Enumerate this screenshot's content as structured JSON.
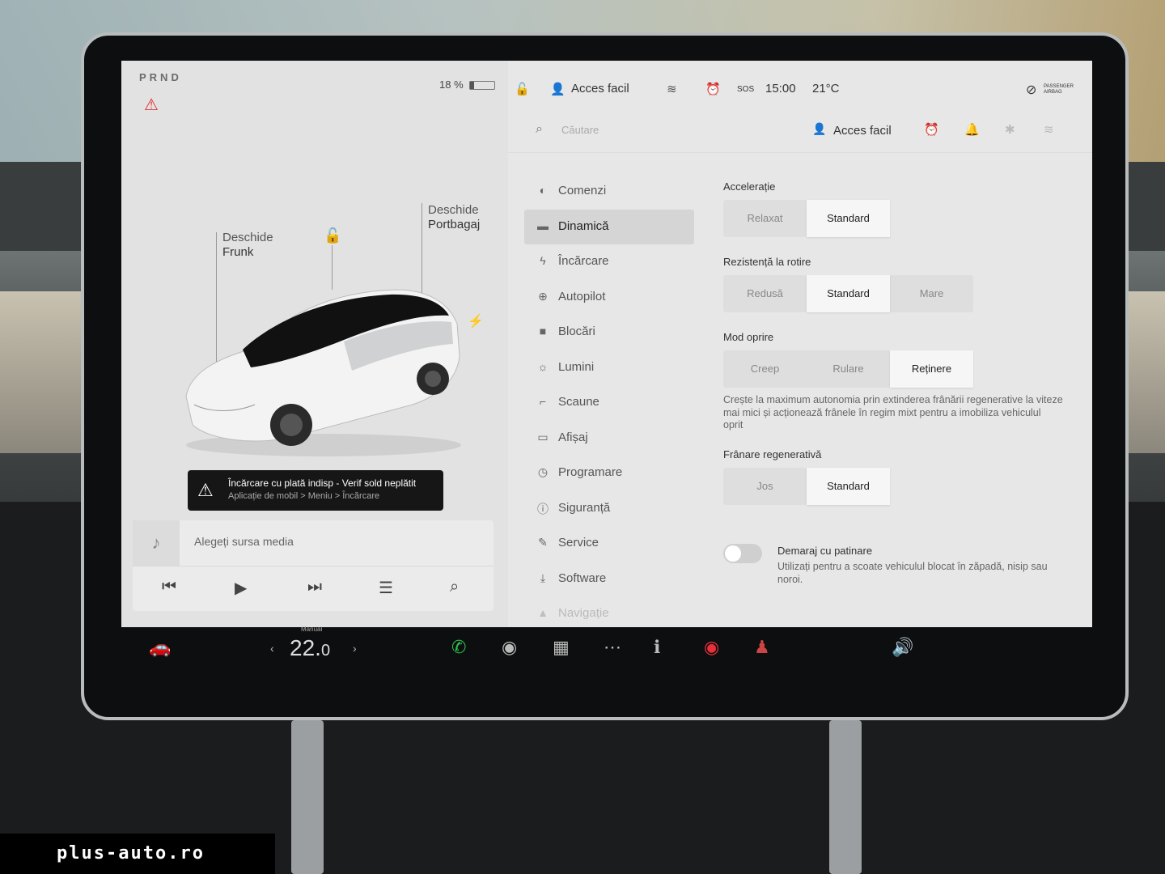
{
  "left": {
    "gear": "PRND",
    "battery_percent": "18 %",
    "battery_level": 0.18,
    "frunk_label_1": "Deschide",
    "frunk_label_2": "Frunk",
    "trunk_label_1": "Deschide",
    "trunk_label_2": "Portbagaj",
    "alert_title": "Încărcare cu plată indisp - Verif sold neplătit",
    "alert_sub": "Aplicație de mobil > Meniu > Încărcare",
    "media_source": "Alegeți sursa media"
  },
  "status": {
    "profile": "Acces facil",
    "sos": "SOS",
    "time": "15:00",
    "temperature": "21°C",
    "airbag": "PASSENGER AIRBAG"
  },
  "search": {
    "placeholder": "Căutare",
    "profile": "Acces facil"
  },
  "menu": [
    {
      "label": "Comenzi",
      "icon": "toggle-icon"
    },
    {
      "label": "Dinamică",
      "icon": "car-icon"
    },
    {
      "label": "Încărcare",
      "icon": "bolt-icon"
    },
    {
      "label": "Autopilot",
      "icon": "steering-icon"
    },
    {
      "label": "Blocări",
      "icon": "lock-icon"
    },
    {
      "label": "Lumini",
      "icon": "sun-icon"
    },
    {
      "label": "Scaune",
      "icon": "seat-icon"
    },
    {
      "label": "Afișaj",
      "icon": "display-icon"
    },
    {
      "label": "Programare",
      "icon": "clock-icon"
    },
    {
      "label": "Siguranță",
      "icon": "info-icon"
    },
    {
      "label": "Service",
      "icon": "wrench-icon"
    },
    {
      "label": "Software",
      "icon": "download-icon"
    },
    {
      "label": "Navigație",
      "icon": "navigation-icon"
    }
  ],
  "settings": {
    "acceleration": {
      "title": "Accelerație",
      "options": [
        "Relaxat",
        "Standard"
      ],
      "selected": "Standard"
    },
    "rolling": {
      "title": "Rezistență la rotire",
      "options": [
        "Redusă",
        "Standard",
        "Mare"
      ],
      "selected": "Standard"
    },
    "stop_mode": {
      "title": "Mod oprire",
      "options": [
        "Creep",
        "Rulare",
        "Reținere"
      ],
      "selected": "Reținere"
    },
    "stop_mode_desc": "Crește la maximum autonomia prin extinderea frânării regenerative la viteze mai mici și acționează frânele în regim mixt pentru a imobiliza vehiculul oprit",
    "regen": {
      "title": "Frânare regenerativă",
      "options": [
        "Jos",
        "Standard"
      ],
      "selected": "Standard"
    },
    "slip_start_title": "Demaraj cu patinare",
    "slip_start_desc": "Utilizați pentru a scoate vehiculul blocat în zăpadă, nisip sau noroi."
  },
  "dock": {
    "climate_mode": "Manual",
    "temp_int": "22.",
    "temp_dec": "0"
  },
  "watermark": "plus-auto.ro"
}
